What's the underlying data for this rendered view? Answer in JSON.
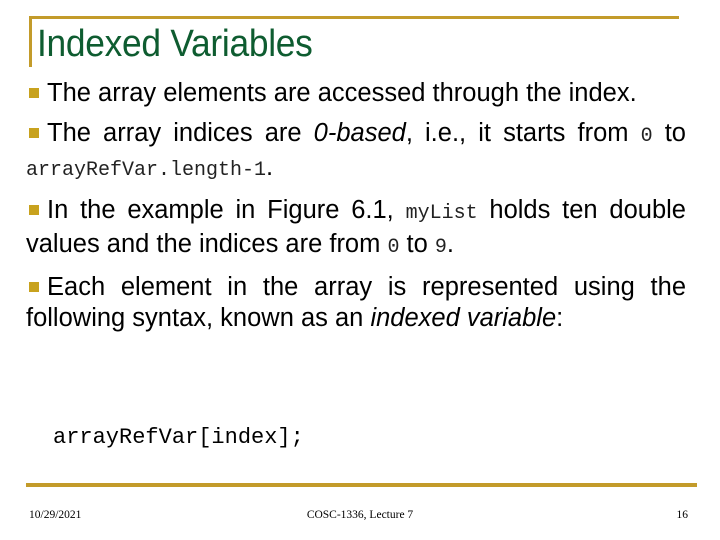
{
  "slide": {
    "title": "Indexed Variables",
    "bullets": [
      {
        "parts": [
          "The array elements are accessed through the index."
        ]
      },
      {
        "pre": "The array indices are ",
        "em": "0-based",
        "mid": ", i.e., it starts from ",
        "code1": "0",
        "to": " to ",
        "code2": "arrayRefVar.length-1",
        "end": "."
      },
      {
        "pre": "In the example in Figure 6.1, ",
        "code1": "myList",
        "mid": " holds ten double values and the indices are from ",
        "code2": "0",
        "to": " to ",
        "code3": "9",
        "end": "."
      },
      {
        "pre": "Each element in the array is represented using the following syntax, known as an ",
        "em1": "indexed variable",
        "end": ":"
      }
    ],
    "code_example": "arrayRefVar[index];"
  },
  "footer": {
    "date": "10/29/2021",
    "center": "COSC-1336, Lecture 7",
    "page": "16"
  },
  "colors": {
    "accent": "#C39B2A",
    "title": "#0E5C30",
    "bullet": "#C8A21E"
  }
}
